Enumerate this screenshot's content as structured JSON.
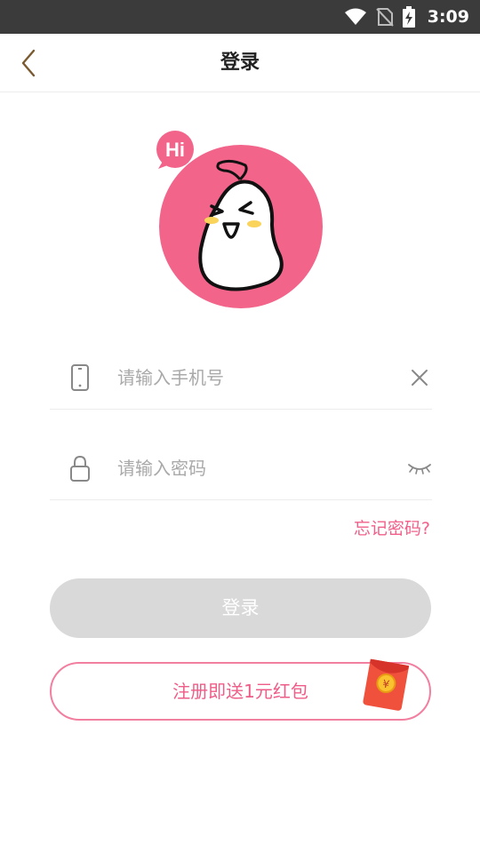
{
  "status_bar": {
    "time": "3:09",
    "icons": [
      "wifi-icon",
      "no-sim-icon",
      "battery-charging-icon"
    ]
  },
  "nav": {
    "title": "登录",
    "back_icon": "chevron-left-icon"
  },
  "avatar": {
    "badge_text": "Hi"
  },
  "phone_field": {
    "placeholder": "请输入手机号",
    "value": "",
    "icon": "phone-icon",
    "action_icon": "clear-icon"
  },
  "password_field": {
    "placeholder": "请输入密码",
    "value": "",
    "icon": "lock-icon",
    "action_icon": "eye-closed-icon"
  },
  "forgot_password": "忘记密码?",
  "login_button": "登录",
  "register_button": "注册即送1元红包",
  "colors": {
    "accent": "#ee5d88",
    "avatar_bg": "#f2648a",
    "button_disabled": "#d9d9d9",
    "status_bar": "#3b3b3b"
  }
}
